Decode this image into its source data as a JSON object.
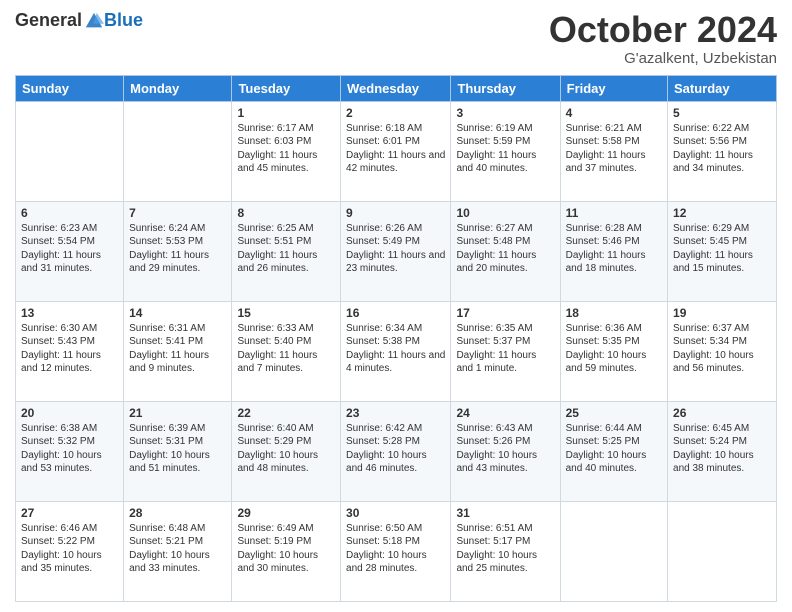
{
  "logo": {
    "general": "General",
    "blue": "Blue"
  },
  "header": {
    "month": "October 2024",
    "location": "G'azalkent, Uzbekistan"
  },
  "weekdays": [
    "Sunday",
    "Monday",
    "Tuesday",
    "Wednesday",
    "Thursday",
    "Friday",
    "Saturday"
  ],
  "weeks": [
    [
      null,
      null,
      {
        "day": "1",
        "sunrise": "Sunrise: 6:17 AM",
        "sunset": "Sunset: 6:03 PM",
        "daylight": "Daylight: 11 hours and 45 minutes."
      },
      {
        "day": "2",
        "sunrise": "Sunrise: 6:18 AM",
        "sunset": "Sunset: 6:01 PM",
        "daylight": "Daylight: 11 hours and 42 minutes."
      },
      {
        "day": "3",
        "sunrise": "Sunrise: 6:19 AM",
        "sunset": "Sunset: 5:59 PM",
        "daylight": "Daylight: 11 hours and 40 minutes."
      },
      {
        "day": "4",
        "sunrise": "Sunrise: 6:21 AM",
        "sunset": "Sunset: 5:58 PM",
        "daylight": "Daylight: 11 hours and 37 minutes."
      },
      {
        "day": "5",
        "sunrise": "Sunrise: 6:22 AM",
        "sunset": "Sunset: 5:56 PM",
        "daylight": "Daylight: 11 hours and 34 minutes."
      }
    ],
    [
      {
        "day": "6",
        "sunrise": "Sunrise: 6:23 AM",
        "sunset": "Sunset: 5:54 PM",
        "daylight": "Daylight: 11 hours and 31 minutes."
      },
      {
        "day": "7",
        "sunrise": "Sunrise: 6:24 AM",
        "sunset": "Sunset: 5:53 PM",
        "daylight": "Daylight: 11 hours and 29 minutes."
      },
      {
        "day": "8",
        "sunrise": "Sunrise: 6:25 AM",
        "sunset": "Sunset: 5:51 PM",
        "daylight": "Daylight: 11 hours and 26 minutes."
      },
      {
        "day": "9",
        "sunrise": "Sunrise: 6:26 AM",
        "sunset": "Sunset: 5:49 PM",
        "daylight": "Daylight: 11 hours and 23 minutes."
      },
      {
        "day": "10",
        "sunrise": "Sunrise: 6:27 AM",
        "sunset": "Sunset: 5:48 PM",
        "daylight": "Daylight: 11 hours and 20 minutes."
      },
      {
        "day": "11",
        "sunrise": "Sunrise: 6:28 AM",
        "sunset": "Sunset: 5:46 PM",
        "daylight": "Daylight: 11 hours and 18 minutes."
      },
      {
        "day": "12",
        "sunrise": "Sunrise: 6:29 AM",
        "sunset": "Sunset: 5:45 PM",
        "daylight": "Daylight: 11 hours and 15 minutes."
      }
    ],
    [
      {
        "day": "13",
        "sunrise": "Sunrise: 6:30 AM",
        "sunset": "Sunset: 5:43 PM",
        "daylight": "Daylight: 11 hours and 12 minutes."
      },
      {
        "day": "14",
        "sunrise": "Sunrise: 6:31 AM",
        "sunset": "Sunset: 5:41 PM",
        "daylight": "Daylight: 11 hours and 9 minutes."
      },
      {
        "day": "15",
        "sunrise": "Sunrise: 6:33 AM",
        "sunset": "Sunset: 5:40 PM",
        "daylight": "Daylight: 11 hours and 7 minutes."
      },
      {
        "day": "16",
        "sunrise": "Sunrise: 6:34 AM",
        "sunset": "Sunset: 5:38 PM",
        "daylight": "Daylight: 11 hours and 4 minutes."
      },
      {
        "day": "17",
        "sunrise": "Sunrise: 6:35 AM",
        "sunset": "Sunset: 5:37 PM",
        "daylight": "Daylight: 11 hours and 1 minute."
      },
      {
        "day": "18",
        "sunrise": "Sunrise: 6:36 AM",
        "sunset": "Sunset: 5:35 PM",
        "daylight": "Daylight: 10 hours and 59 minutes."
      },
      {
        "day": "19",
        "sunrise": "Sunrise: 6:37 AM",
        "sunset": "Sunset: 5:34 PM",
        "daylight": "Daylight: 10 hours and 56 minutes."
      }
    ],
    [
      {
        "day": "20",
        "sunrise": "Sunrise: 6:38 AM",
        "sunset": "Sunset: 5:32 PM",
        "daylight": "Daylight: 10 hours and 53 minutes."
      },
      {
        "day": "21",
        "sunrise": "Sunrise: 6:39 AM",
        "sunset": "Sunset: 5:31 PM",
        "daylight": "Daylight: 10 hours and 51 minutes."
      },
      {
        "day": "22",
        "sunrise": "Sunrise: 6:40 AM",
        "sunset": "Sunset: 5:29 PM",
        "daylight": "Daylight: 10 hours and 48 minutes."
      },
      {
        "day": "23",
        "sunrise": "Sunrise: 6:42 AM",
        "sunset": "Sunset: 5:28 PM",
        "daylight": "Daylight: 10 hours and 46 minutes."
      },
      {
        "day": "24",
        "sunrise": "Sunrise: 6:43 AM",
        "sunset": "Sunset: 5:26 PM",
        "daylight": "Daylight: 10 hours and 43 minutes."
      },
      {
        "day": "25",
        "sunrise": "Sunrise: 6:44 AM",
        "sunset": "Sunset: 5:25 PM",
        "daylight": "Daylight: 10 hours and 40 minutes."
      },
      {
        "day": "26",
        "sunrise": "Sunrise: 6:45 AM",
        "sunset": "Sunset: 5:24 PM",
        "daylight": "Daylight: 10 hours and 38 minutes."
      }
    ],
    [
      {
        "day": "27",
        "sunrise": "Sunrise: 6:46 AM",
        "sunset": "Sunset: 5:22 PM",
        "daylight": "Daylight: 10 hours and 35 minutes."
      },
      {
        "day": "28",
        "sunrise": "Sunrise: 6:48 AM",
        "sunset": "Sunset: 5:21 PM",
        "daylight": "Daylight: 10 hours and 33 minutes."
      },
      {
        "day": "29",
        "sunrise": "Sunrise: 6:49 AM",
        "sunset": "Sunset: 5:19 PM",
        "daylight": "Daylight: 10 hours and 30 minutes."
      },
      {
        "day": "30",
        "sunrise": "Sunrise: 6:50 AM",
        "sunset": "Sunset: 5:18 PM",
        "daylight": "Daylight: 10 hours and 28 minutes."
      },
      {
        "day": "31",
        "sunrise": "Sunrise: 6:51 AM",
        "sunset": "Sunset: 5:17 PM",
        "daylight": "Daylight: 10 hours and 25 minutes."
      },
      null,
      null
    ]
  ]
}
